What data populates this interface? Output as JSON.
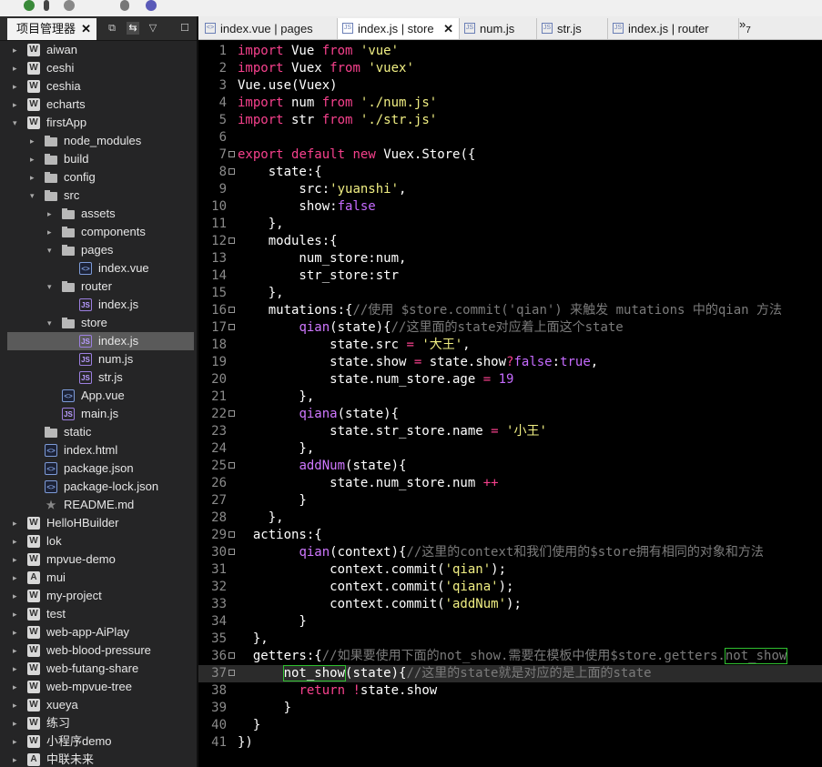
{
  "left_panel": {
    "tab_label": "项目管理器",
    "close_glyph": "✕",
    "buttons": [
      "⧉",
      "⇆",
      "▽",
      "☐"
    ],
    "tree": [
      {
        "label": "aiwan",
        "icon": "W",
        "depth": 0,
        "arrow": "▸"
      },
      {
        "label": "ceshi",
        "icon": "W",
        "depth": 0,
        "arrow": "▸"
      },
      {
        "label": "ceshia",
        "icon": "W",
        "depth": 0,
        "arrow": "▸"
      },
      {
        "label": "echarts",
        "icon": "W",
        "depth": 0,
        "arrow": "▸"
      },
      {
        "label": "firstApp",
        "icon": "W",
        "depth": 0,
        "arrow": "▾"
      },
      {
        "label": "node_modules",
        "icon": "folder",
        "depth": 1,
        "arrow": "▸"
      },
      {
        "label": "build",
        "icon": "folder",
        "depth": 1,
        "arrow": "▸"
      },
      {
        "label": "config",
        "icon": "folder",
        "depth": 1,
        "arrow": "▸"
      },
      {
        "label": "src",
        "icon": "folder",
        "depth": 1,
        "arrow": "▾"
      },
      {
        "label": "assets",
        "icon": "folder",
        "depth": 2,
        "arrow": "▸"
      },
      {
        "label": "components",
        "icon": "folder",
        "depth": 2,
        "arrow": "▸"
      },
      {
        "label": "pages",
        "icon": "folder",
        "depth": 2,
        "arrow": "▾"
      },
      {
        "label": "index.vue",
        "icon": "file",
        "depth": 3,
        "arrow": ""
      },
      {
        "label": "router",
        "icon": "folder",
        "depth": 2,
        "arrow": "▾"
      },
      {
        "label": "index.js",
        "icon": "jsf",
        "depth": 3,
        "arrow": ""
      },
      {
        "label": "store",
        "icon": "folder",
        "depth": 2,
        "arrow": "▾"
      },
      {
        "label": "index.js",
        "icon": "jsf",
        "depth": 3,
        "arrow": "",
        "selected": true
      },
      {
        "label": "num.js",
        "icon": "jsf",
        "depth": 3,
        "arrow": ""
      },
      {
        "label": "str.js",
        "icon": "jsf",
        "depth": 3,
        "arrow": ""
      },
      {
        "label": "App.vue",
        "icon": "file",
        "depth": 2,
        "arrow": ""
      },
      {
        "label": "main.js",
        "icon": "jsf",
        "depth": 2,
        "arrow": ""
      },
      {
        "label": "static",
        "icon": "folder",
        "depth": 1,
        "arrow": ""
      },
      {
        "label": "index.html",
        "icon": "file",
        "depth": 1,
        "arrow": ""
      },
      {
        "label": "package.json",
        "icon": "file",
        "depth": 1,
        "arrow": ""
      },
      {
        "label": "package-lock.json",
        "icon": "file",
        "depth": 1,
        "arrow": ""
      },
      {
        "label": "README.md",
        "icon": "star",
        "depth": 1,
        "arrow": ""
      },
      {
        "label": "HelloHBuilder",
        "icon": "W",
        "depth": 0,
        "arrow": "▸"
      },
      {
        "label": "lok",
        "icon": "W",
        "depth": 0,
        "arrow": "▸"
      },
      {
        "label": "mpvue-demo",
        "icon": "W",
        "depth": 0,
        "arrow": "▸"
      },
      {
        "label": "mui",
        "icon": "A",
        "depth": 0,
        "arrow": "▸"
      },
      {
        "label": "my-project",
        "icon": "W",
        "depth": 0,
        "arrow": "▸"
      },
      {
        "label": "test",
        "icon": "W",
        "depth": 0,
        "arrow": "▸"
      },
      {
        "label": "web-app-AiPlay",
        "icon": "W",
        "depth": 0,
        "arrow": "▸"
      },
      {
        "label": "web-blood-pressure",
        "icon": "W",
        "depth": 0,
        "arrow": "▸"
      },
      {
        "label": "web-futang-share",
        "icon": "W",
        "depth": 0,
        "arrow": "▸"
      },
      {
        "label": "web-mpvue-tree",
        "icon": "W",
        "depth": 0,
        "arrow": "▸"
      },
      {
        "label": "xueya",
        "icon": "W",
        "depth": 0,
        "arrow": "▸"
      },
      {
        "label": "练习",
        "icon": "W",
        "depth": 0,
        "arrow": "▸"
      },
      {
        "label": "小程序demo",
        "icon": "W",
        "depth": 0,
        "arrow": "▸"
      },
      {
        "label": "中联未来",
        "icon": "A",
        "depth": 0,
        "arrow": "▸"
      }
    ]
  },
  "editor": {
    "tabs": [
      {
        "label": "index.vue | pages",
        "icon": "<>",
        "active": false
      },
      {
        "label": "index.js | store",
        "icon": "JS",
        "active": true,
        "close": "✕"
      },
      {
        "label": "num.js",
        "icon": "JS",
        "active": false
      },
      {
        "label": "str.js",
        "icon": "JS",
        "active": false
      },
      {
        "label": "index.js | router",
        "icon": "JS",
        "active": false
      }
    ],
    "overflow_label": "»",
    "overflow_count": "7",
    "current_line": 37,
    "lines": [
      [
        [
          "kw",
          "import"
        ],
        [
          "t",
          " Vue "
        ],
        [
          "kw",
          "from"
        ],
        [
          "t",
          " "
        ],
        [
          "str",
          "'vue'"
        ]
      ],
      [
        [
          "kw",
          "import"
        ],
        [
          "t",
          " Vuex "
        ],
        [
          "kw",
          "from"
        ],
        [
          "t",
          " "
        ],
        [
          "str",
          "'vuex'"
        ]
      ],
      [
        [
          "t",
          "Vue.use(Vuex)"
        ]
      ],
      [
        [
          "kw",
          "import"
        ],
        [
          "t",
          " num "
        ],
        [
          "kw",
          "from"
        ],
        [
          "t",
          " "
        ],
        [
          "str",
          "'./num.js'"
        ]
      ],
      [
        [
          "kw",
          "import"
        ],
        [
          "t",
          " str "
        ],
        [
          "kw",
          "from"
        ],
        [
          "t",
          " "
        ],
        [
          "str",
          "'./str.js'"
        ]
      ],
      [],
      [
        [
          "kw",
          "export"
        ],
        [
          "t",
          " "
        ],
        [
          "kw",
          "default"
        ],
        [
          "t",
          " "
        ],
        [
          "kw",
          "new"
        ],
        [
          "t",
          " Vuex.Store({"
        ]
      ],
      [
        [
          "t",
          "    state:{"
        ]
      ],
      [
        [
          "t",
          "        src:"
        ],
        [
          "str",
          "'yuanshi'"
        ],
        [
          "t",
          ","
        ]
      ],
      [
        [
          "t",
          "        show:"
        ],
        [
          "bool",
          "false"
        ]
      ],
      [
        [
          "t",
          "    },"
        ]
      ],
      [
        [
          "t",
          "    modules:{"
        ]
      ],
      [
        [
          "t",
          "        num_store:num,"
        ]
      ],
      [
        [
          "t",
          "        str_store:str"
        ]
      ],
      [
        [
          "t",
          "    },"
        ]
      ],
      [
        [
          "t",
          "    mutations:{"
        ],
        [
          "cm",
          "//使用 $store.commit('qian') 来触发 mutations 中的qian 方法"
        ]
      ],
      [
        [
          "t",
          "        "
        ],
        [
          "fn",
          "qian"
        ],
        [
          "t",
          "(state){"
        ],
        [
          "cm",
          "//这里面的state对应着上面这个state"
        ]
      ],
      [
        [
          "t",
          "            state.src "
        ],
        [
          "op",
          "="
        ],
        [
          "t",
          " "
        ],
        [
          "str",
          "'大王'"
        ],
        [
          "t",
          ","
        ]
      ],
      [
        [
          "t",
          "            state.show "
        ],
        [
          "op",
          "="
        ],
        [
          "t",
          " state.show"
        ],
        [
          "op",
          "?"
        ],
        [
          "bool",
          "false"
        ],
        [
          "t",
          ":"
        ],
        [
          "bool",
          "true"
        ],
        [
          "t",
          ","
        ]
      ],
      [
        [
          "t",
          "            state.num_store.age "
        ],
        [
          "op",
          "="
        ],
        [
          "t",
          " "
        ],
        [
          "nm",
          "19"
        ]
      ],
      [
        [
          "t",
          "        },"
        ]
      ],
      [
        [
          "t",
          "        "
        ],
        [
          "fn",
          "qiana"
        ],
        [
          "t",
          "(state){"
        ]
      ],
      [
        [
          "t",
          "            state.str_store.name "
        ],
        [
          "op",
          "="
        ],
        [
          "t",
          " "
        ],
        [
          "str",
          "'小王'"
        ]
      ],
      [
        [
          "t",
          "        },"
        ]
      ],
      [
        [
          "t",
          "        "
        ],
        [
          "fn",
          "addNum"
        ],
        [
          "t",
          "(state){"
        ]
      ],
      [
        [
          "t",
          "            state.num_store.num "
        ],
        [
          "op",
          "++"
        ]
      ],
      [
        [
          "t",
          "        }"
        ]
      ],
      [
        [
          "t",
          "    },"
        ]
      ],
      [
        [
          "t",
          "  actions:{"
        ]
      ],
      [
        [
          "t",
          "        "
        ],
        [
          "fn",
          "qian"
        ],
        [
          "t",
          "(context){"
        ],
        [
          "cm",
          "//这里的context和我们使用的$store拥有相同的对象和方法"
        ]
      ],
      [
        [
          "t",
          "            context.commit("
        ],
        [
          "str",
          "'qian'"
        ],
        [
          "t",
          ");"
        ]
      ],
      [
        [
          "t",
          "            context.commit("
        ],
        [
          "str",
          "'qiana'"
        ],
        [
          "t",
          ");"
        ]
      ],
      [
        [
          "t",
          "            context.commit("
        ],
        [
          "str",
          "'addNum'"
        ],
        [
          "t",
          ");"
        ]
      ],
      [
        [
          "t",
          "        }"
        ]
      ],
      [
        [
          "t",
          "  },"
        ]
      ],
      [
        [
          "t",
          "  getters:{"
        ],
        [
          "cm",
          "//如果要使用下面的not_show.需要在模板中使用$store.getters."
        ],
        [
          "hlcm",
          "not_show"
        ]
      ],
      [
        [
          "t",
          "      "
        ],
        [
          "hl",
          "not_show"
        ],
        [
          "t",
          "(state){"
        ],
        [
          "cm",
          "//这里的state就是对应的是上面的state"
        ]
      ],
      [
        [
          "t",
          "        "
        ],
        [
          "kw",
          "return"
        ],
        [
          "t",
          " "
        ],
        [
          "op",
          "!"
        ],
        [
          "t",
          "state.show"
        ]
      ],
      [
        [
          "t",
          "      }"
        ]
      ],
      [
        [
          "t",
          "  }"
        ]
      ],
      [
        [
          "t",
          "})"
        ]
      ]
    ],
    "fold_lines": [
      7,
      8,
      12,
      16,
      17,
      22,
      25,
      29,
      30,
      36,
      37
    ]
  }
}
